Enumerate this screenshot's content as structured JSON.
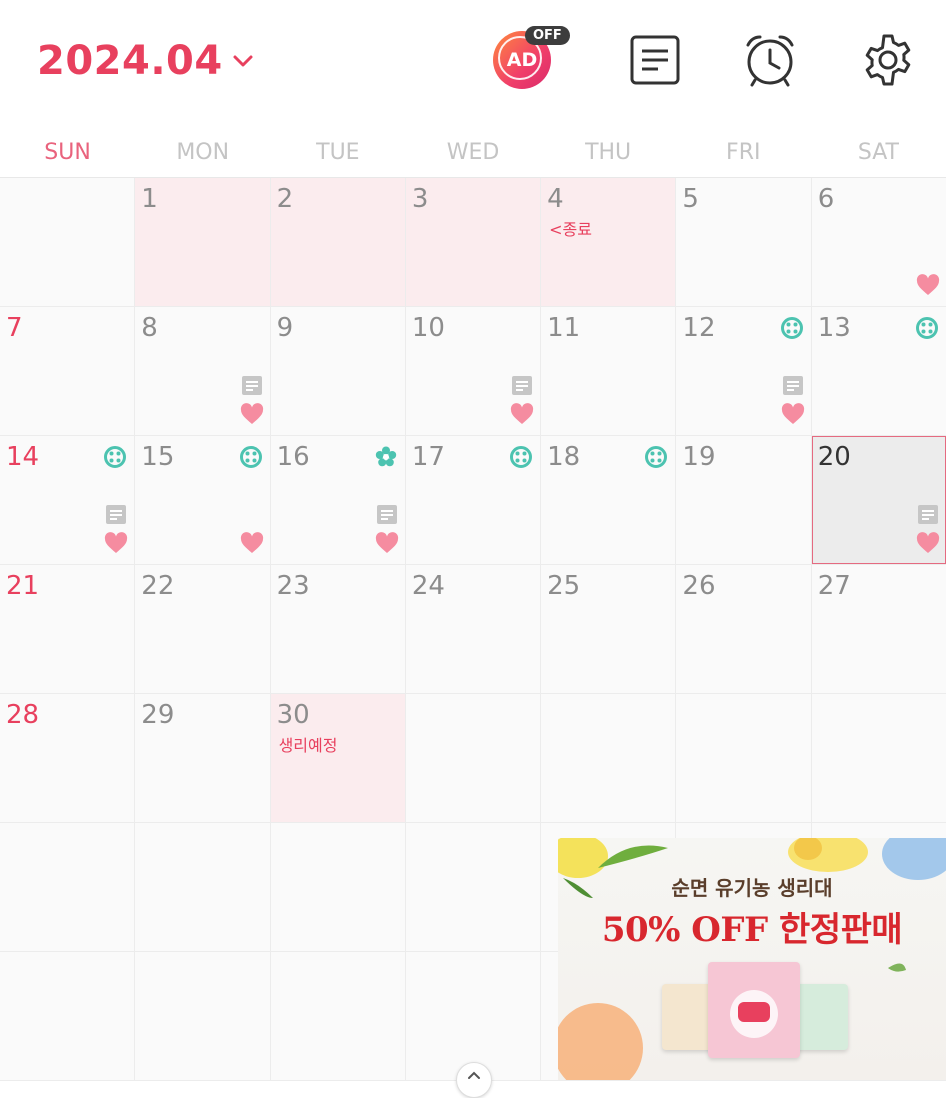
{
  "header": {
    "month_label": "2024.04",
    "ad_toggle_label": "AD",
    "ad_toggle_state": "OFF"
  },
  "weekdays": [
    "SUN",
    "MON",
    "TUE",
    "WED",
    "THU",
    "FRI",
    "SAT"
  ],
  "calendar": {
    "today": "20",
    "notes": {
      "end_label": "<종료",
      "expected_label": "생리예정"
    }
  },
  "ad_banner": {
    "subtitle": "순면 유기농 생리대",
    "headline": "50% OFF 한정판매"
  },
  "colors": {
    "accent": "#e8405e",
    "heart": "#f58ca0",
    "pill": "#4cc3b0",
    "period_bg": "#fbecee"
  }
}
